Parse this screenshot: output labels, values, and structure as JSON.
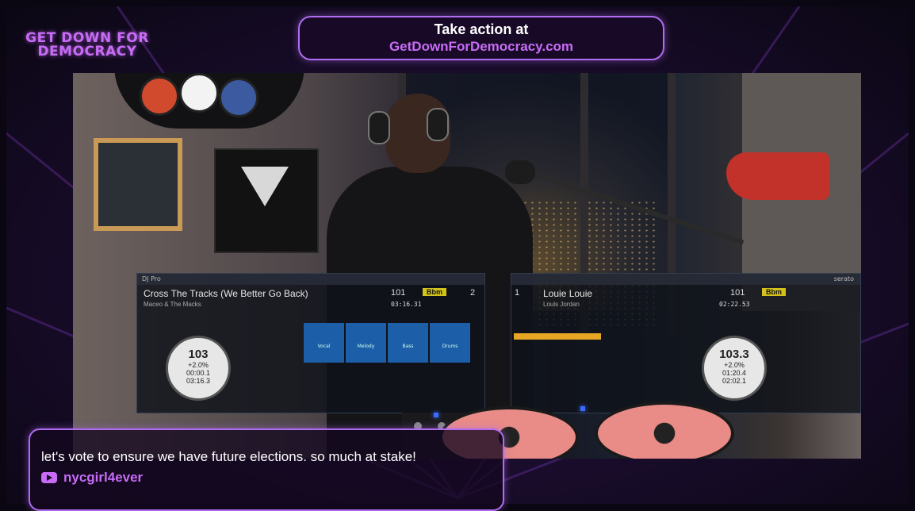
{
  "branding": {
    "logo_line1": "GET DOWN FOR",
    "logo_line2": "DEMOCRACY"
  },
  "cta": {
    "line1": "Take action at",
    "line2": "GetDownForDemocracy.com"
  },
  "serato_left": {
    "app": "DJ Pro",
    "track_title": "Cross The Tracks (We Better Go Back)",
    "artist": "Maceo & The Macks",
    "bpm": "101",
    "key": "Bbm",
    "deck_number": "2",
    "track_length": "03:16.31",
    "platter_bpm": "103",
    "platter_pitch": "+2.0%",
    "elapsed": "00:00.1",
    "remaining": "03:16.3",
    "pads": [
      "Vocal",
      "Melody",
      "Bass",
      "Drums"
    ]
  },
  "serato_right": {
    "brand": "serato",
    "track_title": "Louie Louie",
    "artist": "Louis Jordan",
    "bpm": "101",
    "key": "Bbm",
    "deck_number": "1",
    "track_length": "02:22.53",
    "platter_bpm": "103.3",
    "platter_pitch": "+2.0%",
    "elapsed": "01:20.4",
    "remaining": "02:02.1"
  },
  "chat": {
    "message": "let's vote to ensure we have future elections. so much at stake!",
    "username": "nycgirl4ever",
    "platform_icon": "youtube-icon"
  },
  "colors": {
    "accent": "#c86cf7",
    "key_yellow": "#d3c21a",
    "platter_pink": "#e98b86"
  }
}
